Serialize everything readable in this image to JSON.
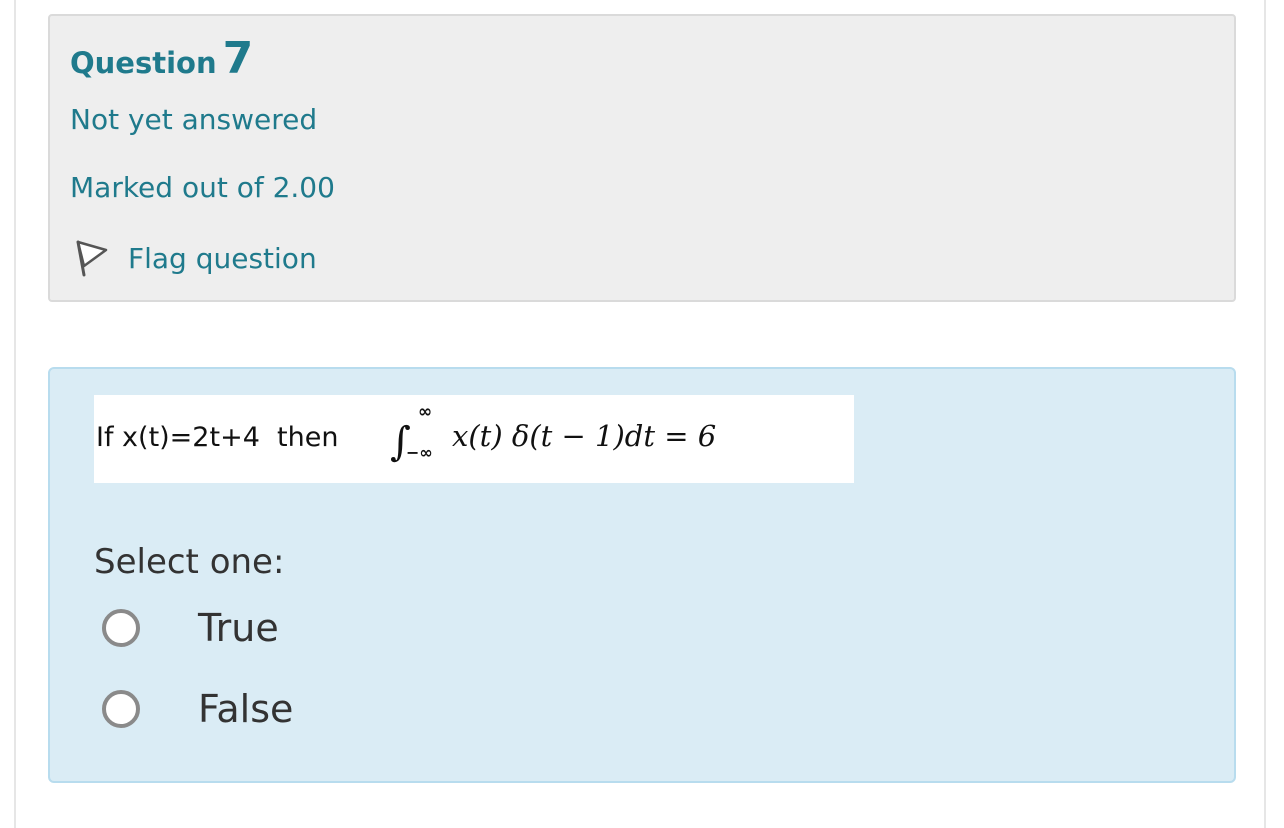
{
  "question": {
    "heading_label": "Question",
    "number": "7",
    "state": "Not yet answered",
    "grade": "Marked out of 2.00",
    "flag_label": "Flag question"
  },
  "formula": {
    "prefix": "If x(t)=2t+4  then",
    "upper_limit": "∞",
    "lower_limit": "−∞",
    "integrand": "x(t) δ(t − 1)dt = 6"
  },
  "answer": {
    "prompt": "Select one:",
    "options": [
      {
        "label": "True"
      },
      {
        "label": "False"
      }
    ]
  },
  "colors": {
    "accent": "#1f7a8c",
    "info_bg": "#eeeeee",
    "content_bg": "#daecf5",
    "content_border": "#b8dcee"
  }
}
